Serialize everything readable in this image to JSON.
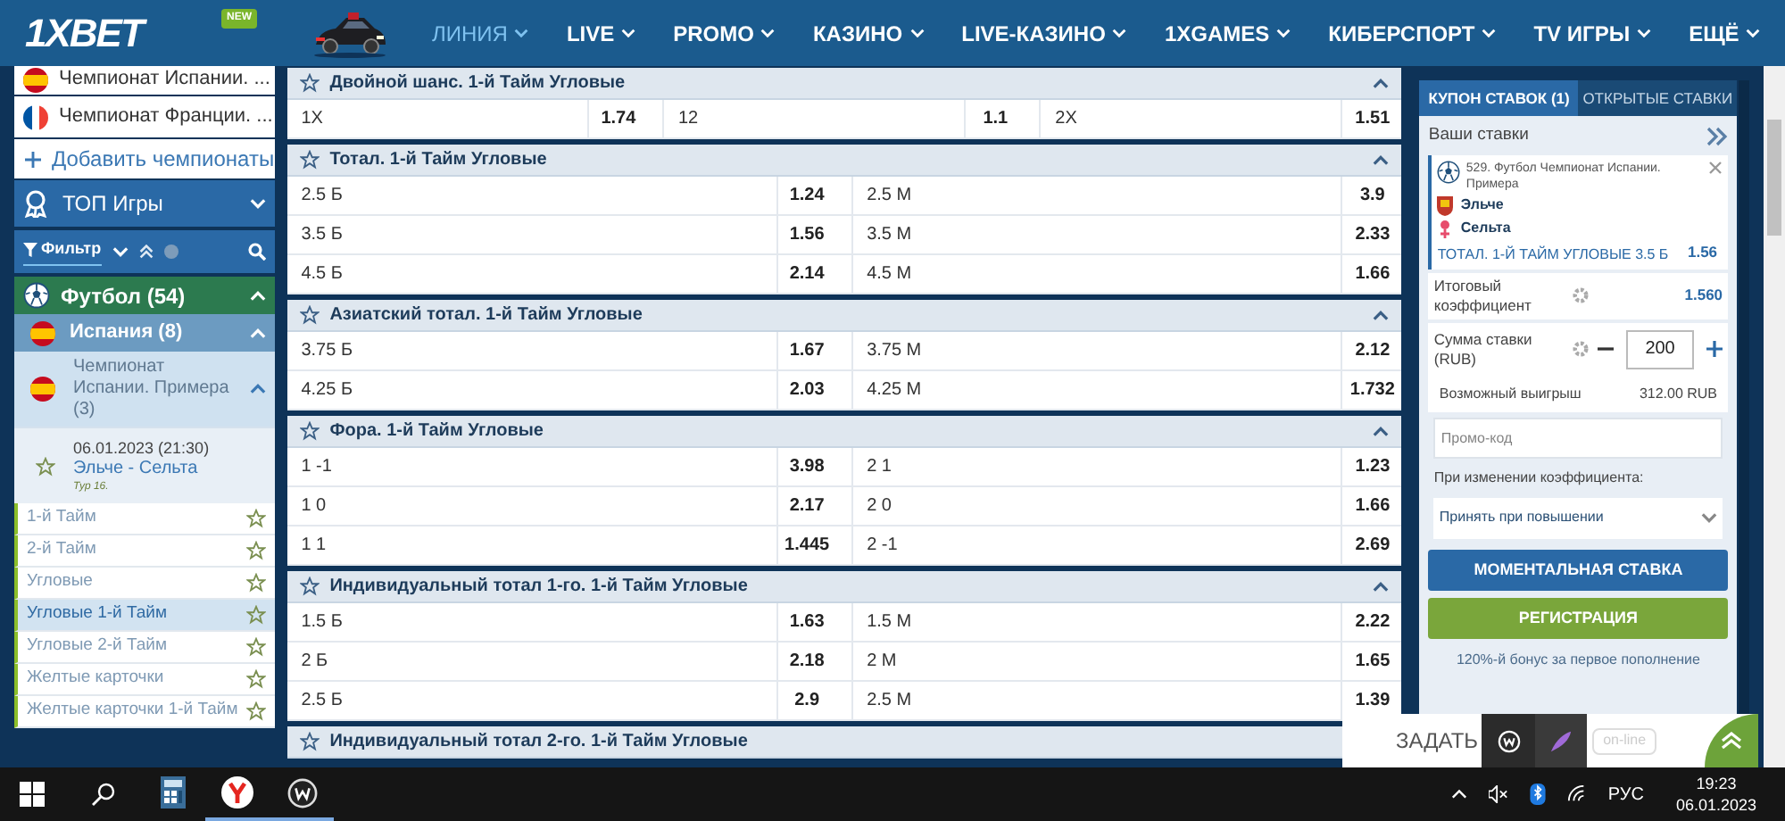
{
  "header": {
    "logo": "1XBET",
    "new_badge": "NEW",
    "nav": [
      {
        "label": "ЛИНИЯ",
        "selected": true
      },
      {
        "label": "LIVE",
        "selected": false
      },
      {
        "label": "PROMO",
        "selected": false
      },
      {
        "label": "КАЗИНО",
        "selected": false
      },
      {
        "label": "LIVE-КАЗИНО",
        "selected": false
      },
      {
        "label": "1XGAMES",
        "selected": false
      },
      {
        "label": "КИБЕРСПОРТ",
        "selected": false
      },
      {
        "label": "TV ИГРЫ",
        "selected": false
      },
      {
        "label": "ЕЩЁ",
        "selected": false
      }
    ]
  },
  "sidebar": {
    "championships": [
      {
        "label": "Чемпионат Испании. ...",
        "kind": "spain"
      },
      {
        "label": "Чемпионат Франции. ...",
        "kind": "france"
      }
    ],
    "add_label": "Добавить чемпионаты",
    "top_games": {
      "label": "ТОП Игры",
      "expanded": false
    },
    "filter": "Фильтр",
    "sport": {
      "label": "Футбол (54)",
      "expanded": true
    },
    "country": {
      "label": "Испания (8)",
      "expanded": true
    },
    "league": {
      "label": "Чемпионат Испании. Примера (3)",
      "expanded": true
    },
    "match": {
      "datetime": "06.01.2023 (21:30)",
      "teams": "Эльче - Сельта",
      "round": "Тур 16."
    },
    "markets": [
      {
        "label": "1-й Тайм",
        "selected": false
      },
      {
        "label": "2-й Тайм",
        "selected": false
      },
      {
        "label": "Угловые",
        "selected": false
      },
      {
        "label": "Угловые 1-й Тайм",
        "selected": true
      },
      {
        "label": "Угловые 2-й Тайм",
        "selected": false
      },
      {
        "label": "Желтые карточки",
        "selected": false
      },
      {
        "label": "Желтые карточки 1-й Тайм",
        "selected": false
      }
    ]
  },
  "markets": [
    {
      "title": "Двойной шанс. 1-й Тайм Угловые",
      "rows": [
        [
          {
            "label": "1X",
            "odds": "1.74"
          },
          {
            "label": "12",
            "odds": "1.1"
          },
          {
            "label": "2X",
            "odds": "1.51"
          }
        ]
      ]
    },
    {
      "title": "Тотал. 1-й Тайм Угловые",
      "rows": [
        [
          {
            "label": "2.5 Б",
            "odds": "1.24"
          },
          {
            "label": "2.5 М",
            "odds": "3.9"
          }
        ],
        [
          {
            "label": "3.5 Б",
            "odds": "1.56"
          },
          {
            "label": "3.5 М",
            "odds": "2.33"
          }
        ],
        [
          {
            "label": "4.5 Б",
            "odds": "2.14"
          },
          {
            "label": "4.5 М",
            "odds": "1.66"
          }
        ]
      ]
    },
    {
      "title": "Азиатский тотал. 1-й Тайм Угловые",
      "rows": [
        [
          {
            "label": "3.75 Б",
            "odds": "1.67"
          },
          {
            "label": "3.75 М",
            "odds": "2.12"
          }
        ],
        [
          {
            "label": "4.25 Б",
            "odds": "2.03"
          },
          {
            "label": "4.25 М",
            "odds": "1.732"
          }
        ]
      ]
    },
    {
      "title": "Фора. 1-й Тайм Угловые",
      "rows": [
        [
          {
            "label": "1 -1",
            "odds": "3.98"
          },
          {
            "label": "2 1",
            "odds": "1.23"
          }
        ],
        [
          {
            "label": "1 0",
            "odds": "2.17"
          },
          {
            "label": "2 0",
            "odds": "1.66"
          }
        ],
        [
          {
            "label": "1 1",
            "odds": "1.445"
          },
          {
            "label": "2 -1",
            "odds": "2.69"
          }
        ]
      ]
    },
    {
      "title": "Индивидуальный тотал 1-го. 1-й Тайм Угловые",
      "rows": [
        [
          {
            "label": "1.5 Б",
            "odds": "1.63"
          },
          {
            "label": "1.5 М",
            "odds": "2.22"
          }
        ],
        [
          {
            "label": "2 Б",
            "odds": "2.18"
          },
          {
            "label": "2 М",
            "odds": "1.65"
          }
        ],
        [
          {
            "label": "2.5 Б",
            "odds": "2.9"
          },
          {
            "label": "2.5 М",
            "odds": "1.39"
          }
        ]
      ]
    },
    {
      "title": "Индивидуальный тотал 2-го. 1-й Тайм Угловые"
    }
  ],
  "coupon": {
    "tabs": [
      {
        "label": "КУПОН СТАВОК (1)",
        "selected": true
      },
      {
        "label": "ОТКРЫТЫЕ СТАВКИ",
        "selected": false
      }
    ],
    "your_bets": "Ваши ставки",
    "bet": {
      "event": "529. Футбол Чемпионат Испании. Примера",
      "team_1": "Эльче",
      "team_2": "Сельта",
      "market": "ТОТАЛ. 1-Й ТАЙМ УГЛОВЫЕ 3.5 Б",
      "odds": "1.56"
    },
    "total_label": "Итоговый коэффициент",
    "total_odds": "1.560",
    "stake_label": "Сумма ставки (RUB)",
    "stake": "200",
    "win_label": "Возможный выигрыш",
    "win": "312.00 RUB",
    "promo_placeholder": "Промо-код",
    "odds_change_label": "При изменении коэффициента:",
    "odds_change_value": "Принять при повышении",
    "quick_bet": "МОМЕНТАЛЬНАЯ СТАВКА",
    "register": "РЕГИСТРАЦИЯ",
    "bonus": "120%-й бонус за первое пополнение"
  },
  "chat": {
    "label": "ЗАДАТЬ",
    "status": "on-line"
  },
  "taskbar": {
    "apps": [
      {
        "kind": "calculator",
        "running": false
      },
      {
        "kind": "browser",
        "running": true
      },
      {
        "kind": "app",
        "running": true
      }
    ],
    "language": "РУС",
    "time": "19:23",
    "date": "06.01.2023"
  }
}
